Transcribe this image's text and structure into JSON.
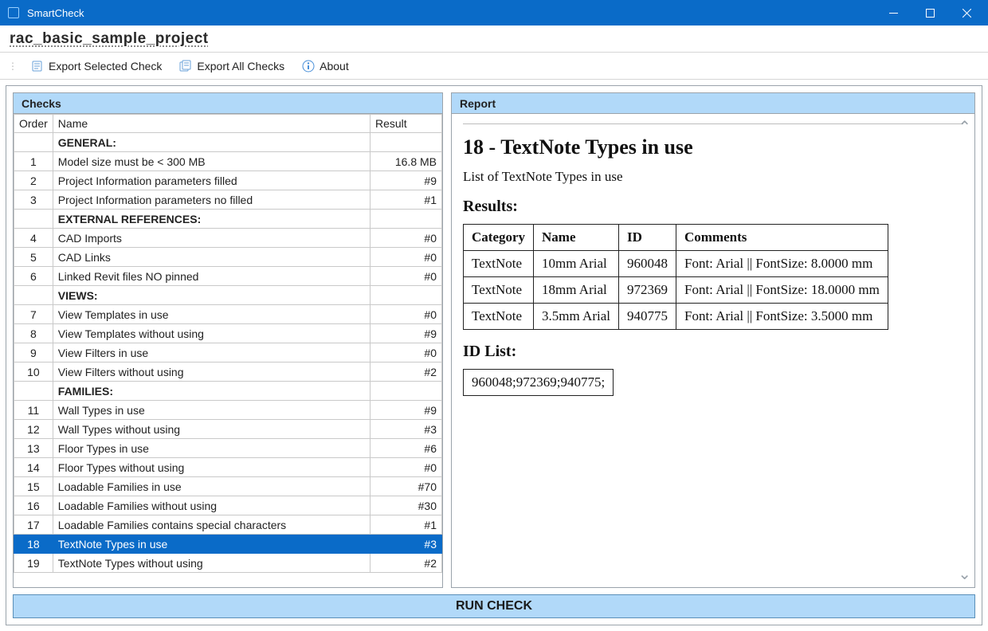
{
  "window": {
    "title": "SmartCheck"
  },
  "project": {
    "name": "rac_basic_sample_project"
  },
  "toolbar": {
    "export_selected": "Export Selected Check",
    "export_all": "Export All Checks",
    "about": "About"
  },
  "panels": {
    "checks_title": "Checks",
    "report_title": "Report"
  },
  "checks_columns": {
    "order": "Order",
    "name": "Name",
    "result": "Result"
  },
  "checks_rows": [
    {
      "type": "section",
      "name": "GENERAL:"
    },
    {
      "type": "item",
      "order": "1",
      "name": "Model size must be < 300 MB",
      "result": "16.8 MB"
    },
    {
      "type": "item",
      "order": "2",
      "name": "Project Information parameters filled",
      "result": "#9"
    },
    {
      "type": "item",
      "order": "3",
      "name": "Project Information parameters no filled",
      "result": "#1"
    },
    {
      "type": "section",
      "name": "EXTERNAL REFERENCES:"
    },
    {
      "type": "item",
      "order": "4",
      "name": "CAD Imports",
      "result": "#0"
    },
    {
      "type": "item",
      "order": "5",
      "name": "CAD Links",
      "result": "#0"
    },
    {
      "type": "item",
      "order": "6",
      "name": "Linked Revit files NO pinned",
      "result": "#0"
    },
    {
      "type": "section",
      "name": "VIEWS:"
    },
    {
      "type": "item",
      "order": "7",
      "name": "View Templates in use",
      "result": "#0"
    },
    {
      "type": "item",
      "order": "8",
      "name": "View Templates without using",
      "result": "#9"
    },
    {
      "type": "item",
      "order": "9",
      "name": "View Filters in use",
      "result": "#0"
    },
    {
      "type": "item",
      "order": "10",
      "name": "View Filters without using",
      "result": "#2"
    },
    {
      "type": "section",
      "name": "FAMILIES:"
    },
    {
      "type": "item",
      "order": "11",
      "name": "Wall Types in use",
      "result": "#9"
    },
    {
      "type": "item",
      "order": "12",
      "name": "Wall Types without using",
      "result": "#3"
    },
    {
      "type": "item",
      "order": "13",
      "name": "Floor Types in use",
      "result": "#6"
    },
    {
      "type": "item",
      "order": "14",
      "name": "Floor Types without using",
      "result": "#0"
    },
    {
      "type": "item",
      "order": "15",
      "name": "Loadable Families in use",
      "result": "#70"
    },
    {
      "type": "item",
      "order": "16",
      "name": "Loadable Families without using",
      "result": "#30"
    },
    {
      "type": "item",
      "order": "17",
      "name": "Loadable Families contains special characters",
      "result": "#1"
    },
    {
      "type": "item",
      "order": "18",
      "name": "TextNote Types in use",
      "result": "#3",
      "selected": true
    },
    {
      "type": "item",
      "order": "19",
      "name": "TextNote Types without using",
      "result": "#2"
    }
  ],
  "report": {
    "title": "18 - TextNote Types in use",
    "description": "List of TextNote Types in use",
    "results_heading": "Results:",
    "idlist_heading": "ID List:",
    "table": {
      "headers": {
        "category": "Category",
        "name": "Name",
        "id": "ID",
        "comments": "Comments"
      },
      "rows": [
        {
          "category": "TextNote",
          "name": "10mm Arial",
          "id": "960048",
          "comments": "Font: Arial || FontSize: 8.0000 mm"
        },
        {
          "category": "TextNote",
          "name": "18mm Arial",
          "id": "972369",
          "comments": "Font: Arial || FontSize: 18.0000 mm"
        },
        {
          "category": "TextNote",
          "name": "3.5mm Arial",
          "id": "940775",
          "comments": "Font: Arial || FontSize: 3.5000 mm"
        }
      ]
    },
    "id_list": "960048;972369;940775;"
  },
  "run_button": "RUN CHECK"
}
